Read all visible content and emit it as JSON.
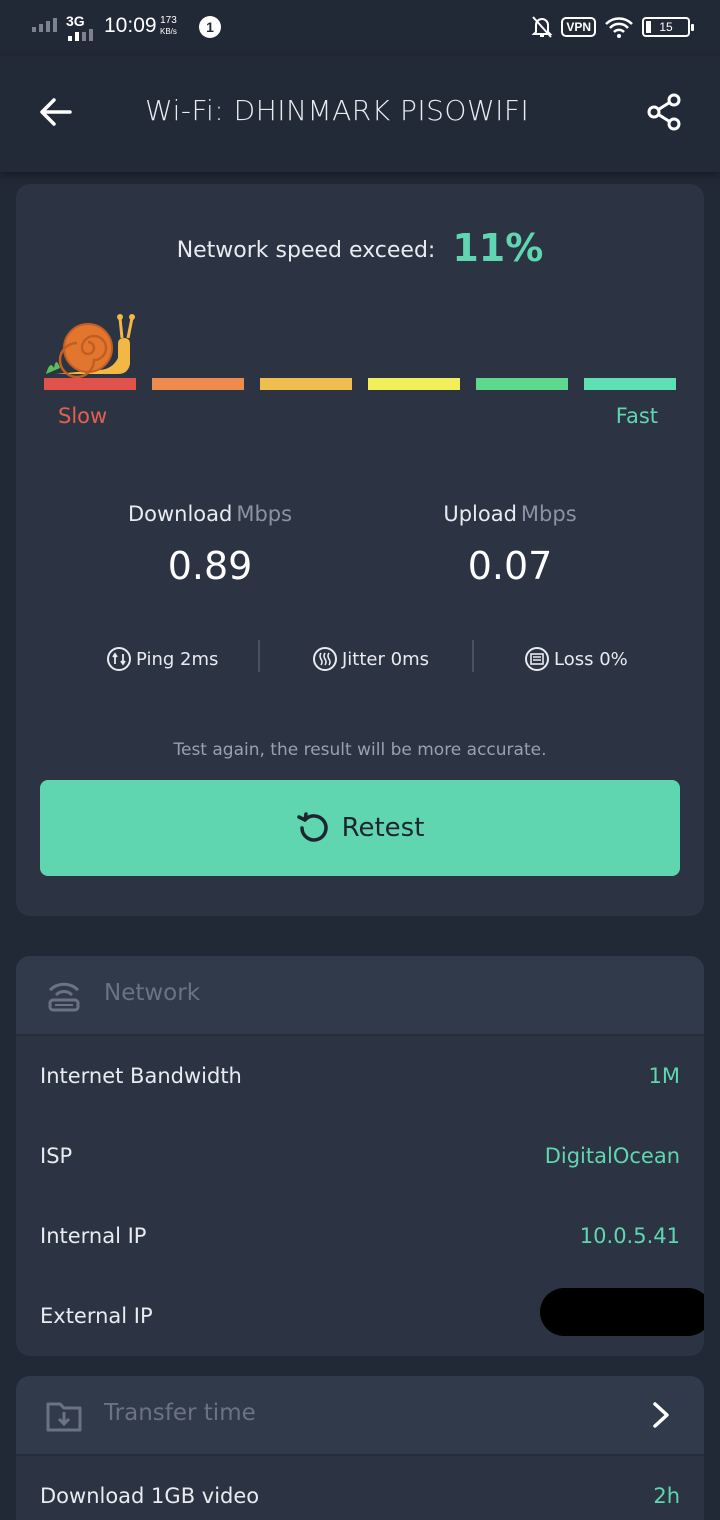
{
  "status_bar": {
    "network_type": "3G",
    "time": "10:09",
    "speed_value": "173",
    "speed_unit": "KB/s",
    "notification_count": "1",
    "vpn_label": "VPN",
    "battery": "15"
  },
  "app_bar": {
    "title": "Wi-Fi: DHINMARK PISOWIFI"
  },
  "speed_card": {
    "exceed_label": "Network speed exceed:",
    "exceed_value": "11%",
    "scale_colors": [
      "#e0524a",
      "#ee8b4e",
      "#f0be50",
      "#f2ee5a",
      "#5ed88c",
      "#5fe0b4"
    ],
    "slow_label": "Slow",
    "fast_label": "Fast",
    "download_label": "Download",
    "download_unit": "Mbps",
    "download_value": "0.89",
    "upload_label": "Upload",
    "upload_unit": "Mbps",
    "upload_value": "0.07",
    "ping": "Ping 2ms",
    "jitter": "Jitter 0ms",
    "loss": "Loss 0%",
    "hint": "Test again, the result will be more accurate.",
    "retest_label": "Retest"
  },
  "network_card": {
    "title": "Network",
    "rows": [
      {
        "label": "Internet Bandwidth",
        "value": "1M"
      },
      {
        "label": "ISP",
        "value": "DigitalOcean"
      },
      {
        "label": "Internal IP",
        "value": "10.0.5.41"
      },
      {
        "label": "External IP",
        "value": ""
      }
    ]
  },
  "transfer_card": {
    "title": "Transfer time",
    "rows": [
      {
        "label": "Download 1GB video",
        "value": "2h"
      }
    ]
  },
  "colors": {
    "accent": "#5fd6b0",
    "background": "#222936",
    "card": "#2c3443",
    "slow": "#e2614e"
  }
}
